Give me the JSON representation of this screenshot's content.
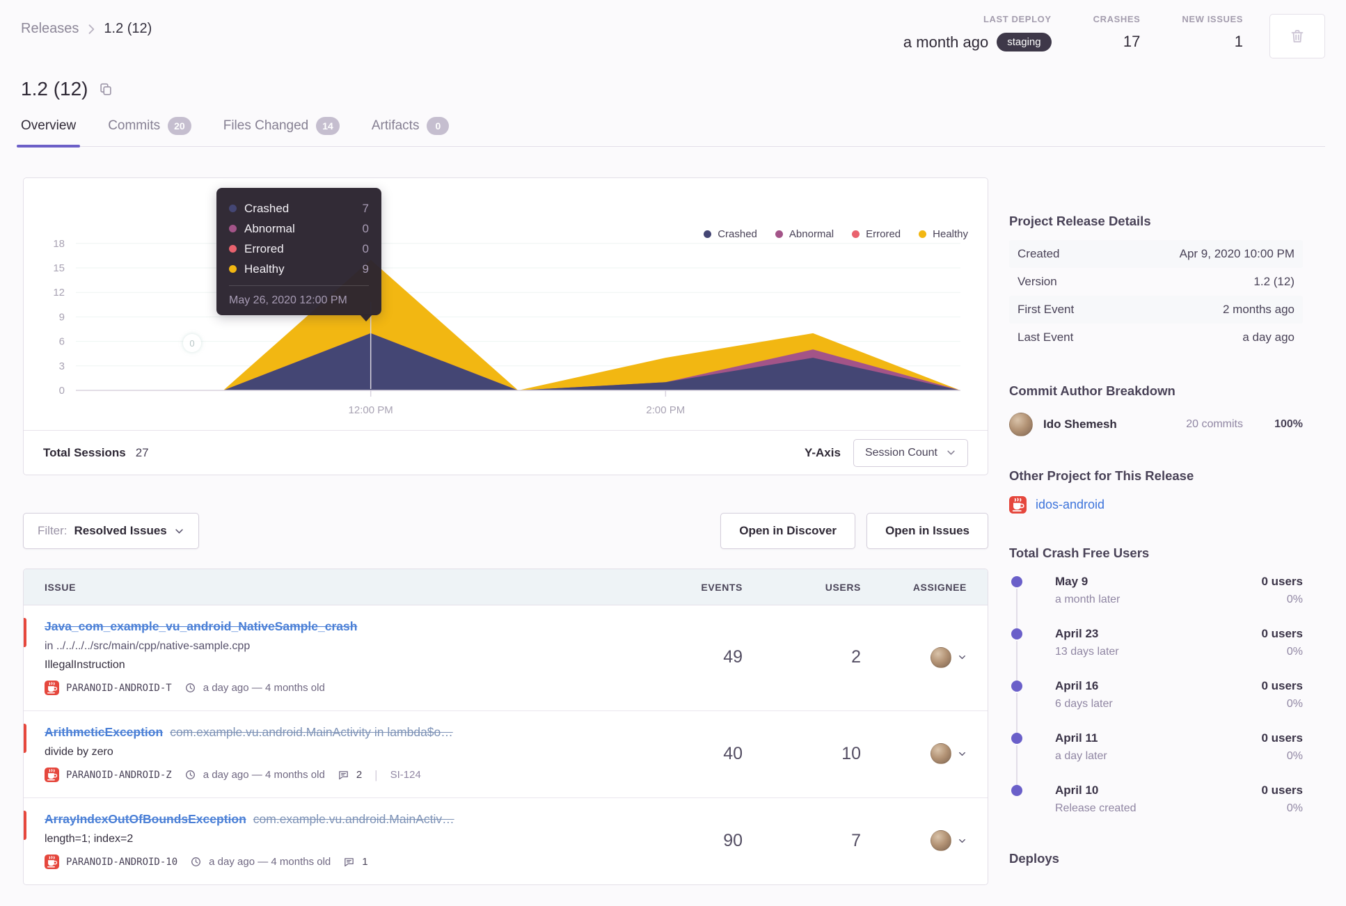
{
  "breadcrumb": {
    "parent": "Releases",
    "current": "1.2 (12)"
  },
  "metrics": {
    "last_deploy": {
      "label": "LAST DEPLOY",
      "value": "a month ago",
      "env": "staging"
    },
    "crashes": {
      "label": "CRASHES",
      "value": "17"
    },
    "new_issues": {
      "label": "NEW ISSUES",
      "value": "1"
    }
  },
  "page_title": "1.2 (12)",
  "tabs": [
    {
      "label": "Overview"
    },
    {
      "label": "Commits",
      "badge": "20"
    },
    {
      "label": "Files Changed",
      "badge": "14"
    },
    {
      "label": "Artifacts",
      "badge": "0"
    }
  ],
  "chart_data": {
    "type": "area",
    "stacked": true,
    "title": "Release session counts over time",
    "x": [
      "10:00 AM",
      "11:00 AM",
      "12:00 PM",
      "1:00 PM",
      "2:00 PM",
      "3:00 PM",
      "4:00 PM"
    ],
    "x_tick_labels": [
      "12:00 PM",
      "2:00 PM"
    ],
    "hover_x_label": "12:00 PM",
    "hover_marker_value": "0",
    "series": [
      {
        "name": "Crashed",
        "color": "#444674",
        "values": [
          0,
          0,
          7,
          0,
          1,
          4,
          0
        ]
      },
      {
        "name": "Abnormal",
        "color": "#a35488",
        "values": [
          0,
          0,
          0,
          0,
          0,
          1,
          0
        ]
      },
      {
        "name": "Errored",
        "color": "#e9626e",
        "values": [
          0,
          0,
          0,
          0,
          0,
          0,
          0
        ]
      },
      {
        "name": "Healthy",
        "color": "#f2b712",
        "values": [
          0,
          0,
          9,
          0,
          3,
          2,
          0
        ]
      }
    ],
    "ylim": [
      0,
      18
    ],
    "y_ticks": [
      0,
      3,
      6,
      9,
      12,
      15,
      18
    ],
    "grid": true,
    "legend_position": "top-right"
  },
  "chart_tooltip": {
    "rows": [
      {
        "name": "Crashed",
        "value": "7",
        "color": "#444674"
      },
      {
        "name": "Abnormal",
        "value": "0",
        "color": "#a35488"
      },
      {
        "name": "Errored",
        "value": "0",
        "color": "#e9626e"
      },
      {
        "name": "Healthy",
        "value": "9",
        "color": "#f2b712"
      }
    ],
    "date": "May 26, 2020 12:00 PM"
  },
  "chart_footer": {
    "total_sessions_label": "Total Sessions",
    "total_sessions_value": "27",
    "y_axis_label": "Y-Axis",
    "y_axis_value": "Session Count"
  },
  "filter": {
    "label": "Filter:",
    "value": "Resolved Issues"
  },
  "actions": {
    "discover": "Open in Discover",
    "issues": "Open in Issues"
  },
  "issues_table": {
    "columns": [
      "ISSUE",
      "EVENTS",
      "USERS",
      "ASSIGNEE"
    ],
    "rows": [
      {
        "title": "Java_com_example_vu_android_NativeSample_crash",
        "culprit": "in ../../../../src/main/cpp/native-sample.cpp",
        "message": "IllegalInstruction",
        "project": "PARANOID-ANDROID-T",
        "age": "a day ago — 4 months old",
        "events": "49",
        "users": "2"
      },
      {
        "title": "ArithmeticException",
        "subtitle": "com.example.vu.android.MainActivity in lambda$o…",
        "message": "divide by zero",
        "project": "PARANOID-ANDROID-Z",
        "age": "a day ago — 4 months old",
        "comments": "2",
        "short_id": "SI-124",
        "events": "40",
        "users": "10"
      },
      {
        "title": "ArrayIndexOutOfBoundsException",
        "subtitle": "com.example.vu.android.MainActiv…",
        "message": "length=1; index=2",
        "project": "PARANOID-ANDROID-10",
        "age": "a day ago — 4 months old",
        "comments": "1",
        "events": "90",
        "users": "7"
      }
    ]
  },
  "sidebar": {
    "release_details": {
      "heading": "Project Release Details",
      "rows": [
        {
          "label": "Created",
          "value": "Apr 9, 2020 10:00 PM"
        },
        {
          "label": "Version",
          "value": "1.2 (12)"
        },
        {
          "label": "First Event",
          "value": "2 months ago"
        },
        {
          "label": "Last Event",
          "value": "a day ago"
        }
      ]
    },
    "commit_authors": {
      "heading": "Commit Author Breakdown",
      "name": "Ido Shemesh",
      "commits": "20 commits",
      "percent": "100%"
    },
    "other_project": {
      "heading": "Other Project for This Release",
      "link": "idos-android"
    },
    "crash_free": {
      "heading": "Total Crash Free Users",
      "entries": [
        {
          "date": "May 9",
          "sub": "a month later",
          "users": "0 users",
          "pct": "0%"
        },
        {
          "date": "April 23",
          "sub": "13 days later",
          "users": "0 users",
          "pct": "0%"
        },
        {
          "date": "April 16",
          "sub": "6 days later",
          "users": "0 users",
          "pct": "0%"
        },
        {
          "date": "April 11",
          "sub": "a day later",
          "users": "0 users",
          "pct": "0%"
        },
        {
          "date": "April 10",
          "sub": "Release created",
          "users": "0 users",
          "pct": "0%"
        }
      ]
    },
    "deploys_heading": "Deploys"
  }
}
